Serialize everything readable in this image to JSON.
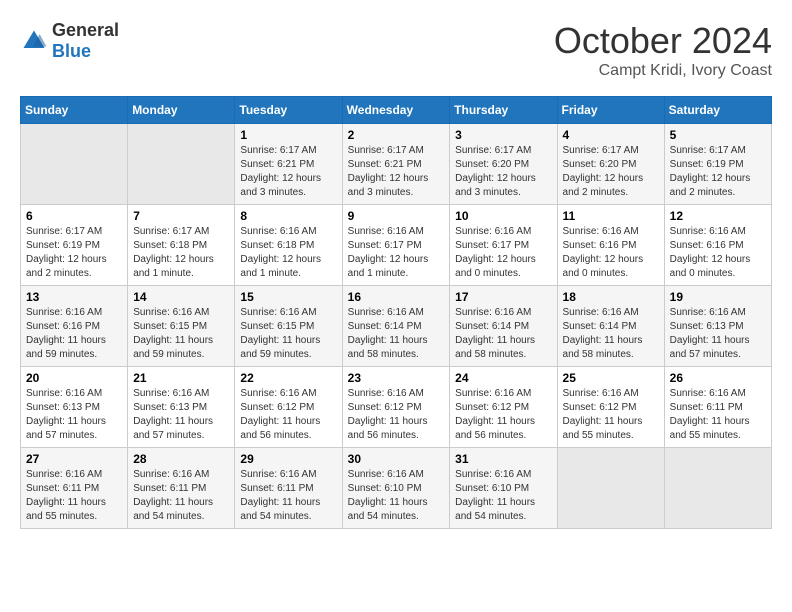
{
  "header": {
    "logo_general": "General",
    "logo_blue": "Blue",
    "month": "October 2024",
    "location": "Campt Kridi, Ivory Coast"
  },
  "weekdays": [
    "Sunday",
    "Monday",
    "Tuesday",
    "Wednesday",
    "Thursday",
    "Friday",
    "Saturday"
  ],
  "weeks": [
    [
      {
        "day": "",
        "sunrise": "",
        "sunset": "",
        "daylight": ""
      },
      {
        "day": "",
        "sunrise": "",
        "sunset": "",
        "daylight": ""
      },
      {
        "day": "1",
        "sunrise": "Sunrise: 6:17 AM",
        "sunset": "Sunset: 6:21 PM",
        "daylight": "Daylight: 12 hours and 3 minutes."
      },
      {
        "day": "2",
        "sunrise": "Sunrise: 6:17 AM",
        "sunset": "Sunset: 6:21 PM",
        "daylight": "Daylight: 12 hours and 3 minutes."
      },
      {
        "day": "3",
        "sunrise": "Sunrise: 6:17 AM",
        "sunset": "Sunset: 6:20 PM",
        "daylight": "Daylight: 12 hours and 3 minutes."
      },
      {
        "day": "4",
        "sunrise": "Sunrise: 6:17 AM",
        "sunset": "Sunset: 6:20 PM",
        "daylight": "Daylight: 12 hours and 2 minutes."
      },
      {
        "day": "5",
        "sunrise": "Sunrise: 6:17 AM",
        "sunset": "Sunset: 6:19 PM",
        "daylight": "Daylight: 12 hours and 2 minutes."
      }
    ],
    [
      {
        "day": "6",
        "sunrise": "Sunrise: 6:17 AM",
        "sunset": "Sunset: 6:19 PM",
        "daylight": "Daylight: 12 hours and 2 minutes."
      },
      {
        "day": "7",
        "sunrise": "Sunrise: 6:17 AM",
        "sunset": "Sunset: 6:18 PM",
        "daylight": "Daylight: 12 hours and 1 minute."
      },
      {
        "day": "8",
        "sunrise": "Sunrise: 6:16 AM",
        "sunset": "Sunset: 6:18 PM",
        "daylight": "Daylight: 12 hours and 1 minute."
      },
      {
        "day": "9",
        "sunrise": "Sunrise: 6:16 AM",
        "sunset": "Sunset: 6:17 PM",
        "daylight": "Daylight: 12 hours and 1 minute."
      },
      {
        "day": "10",
        "sunrise": "Sunrise: 6:16 AM",
        "sunset": "Sunset: 6:17 PM",
        "daylight": "Daylight: 12 hours and 0 minutes."
      },
      {
        "day": "11",
        "sunrise": "Sunrise: 6:16 AM",
        "sunset": "Sunset: 6:16 PM",
        "daylight": "Daylight: 12 hours and 0 minutes."
      },
      {
        "day": "12",
        "sunrise": "Sunrise: 6:16 AM",
        "sunset": "Sunset: 6:16 PM",
        "daylight": "Daylight: 12 hours and 0 minutes."
      }
    ],
    [
      {
        "day": "13",
        "sunrise": "Sunrise: 6:16 AM",
        "sunset": "Sunset: 6:16 PM",
        "daylight": "Daylight: 11 hours and 59 minutes."
      },
      {
        "day": "14",
        "sunrise": "Sunrise: 6:16 AM",
        "sunset": "Sunset: 6:15 PM",
        "daylight": "Daylight: 11 hours and 59 minutes."
      },
      {
        "day": "15",
        "sunrise": "Sunrise: 6:16 AM",
        "sunset": "Sunset: 6:15 PM",
        "daylight": "Daylight: 11 hours and 59 minutes."
      },
      {
        "day": "16",
        "sunrise": "Sunrise: 6:16 AM",
        "sunset": "Sunset: 6:14 PM",
        "daylight": "Daylight: 11 hours and 58 minutes."
      },
      {
        "day": "17",
        "sunrise": "Sunrise: 6:16 AM",
        "sunset": "Sunset: 6:14 PM",
        "daylight": "Daylight: 11 hours and 58 minutes."
      },
      {
        "day": "18",
        "sunrise": "Sunrise: 6:16 AM",
        "sunset": "Sunset: 6:14 PM",
        "daylight": "Daylight: 11 hours and 58 minutes."
      },
      {
        "day": "19",
        "sunrise": "Sunrise: 6:16 AM",
        "sunset": "Sunset: 6:13 PM",
        "daylight": "Daylight: 11 hours and 57 minutes."
      }
    ],
    [
      {
        "day": "20",
        "sunrise": "Sunrise: 6:16 AM",
        "sunset": "Sunset: 6:13 PM",
        "daylight": "Daylight: 11 hours and 57 minutes."
      },
      {
        "day": "21",
        "sunrise": "Sunrise: 6:16 AM",
        "sunset": "Sunset: 6:13 PM",
        "daylight": "Daylight: 11 hours and 57 minutes."
      },
      {
        "day": "22",
        "sunrise": "Sunrise: 6:16 AM",
        "sunset": "Sunset: 6:12 PM",
        "daylight": "Daylight: 11 hours and 56 minutes."
      },
      {
        "day": "23",
        "sunrise": "Sunrise: 6:16 AM",
        "sunset": "Sunset: 6:12 PM",
        "daylight": "Daylight: 11 hours and 56 minutes."
      },
      {
        "day": "24",
        "sunrise": "Sunrise: 6:16 AM",
        "sunset": "Sunset: 6:12 PM",
        "daylight": "Daylight: 11 hours and 56 minutes."
      },
      {
        "day": "25",
        "sunrise": "Sunrise: 6:16 AM",
        "sunset": "Sunset: 6:12 PM",
        "daylight": "Daylight: 11 hours and 55 minutes."
      },
      {
        "day": "26",
        "sunrise": "Sunrise: 6:16 AM",
        "sunset": "Sunset: 6:11 PM",
        "daylight": "Daylight: 11 hours and 55 minutes."
      }
    ],
    [
      {
        "day": "27",
        "sunrise": "Sunrise: 6:16 AM",
        "sunset": "Sunset: 6:11 PM",
        "daylight": "Daylight: 11 hours and 55 minutes."
      },
      {
        "day": "28",
        "sunrise": "Sunrise: 6:16 AM",
        "sunset": "Sunset: 6:11 PM",
        "daylight": "Daylight: 11 hours and 54 minutes."
      },
      {
        "day": "29",
        "sunrise": "Sunrise: 6:16 AM",
        "sunset": "Sunset: 6:11 PM",
        "daylight": "Daylight: 11 hours and 54 minutes."
      },
      {
        "day": "30",
        "sunrise": "Sunrise: 6:16 AM",
        "sunset": "Sunset: 6:10 PM",
        "daylight": "Daylight: 11 hours and 54 minutes."
      },
      {
        "day": "31",
        "sunrise": "Sunrise: 6:16 AM",
        "sunset": "Sunset: 6:10 PM",
        "daylight": "Daylight: 11 hours and 54 minutes."
      },
      {
        "day": "",
        "sunrise": "",
        "sunset": "",
        "daylight": ""
      },
      {
        "day": "",
        "sunrise": "",
        "sunset": "",
        "daylight": ""
      }
    ]
  ]
}
